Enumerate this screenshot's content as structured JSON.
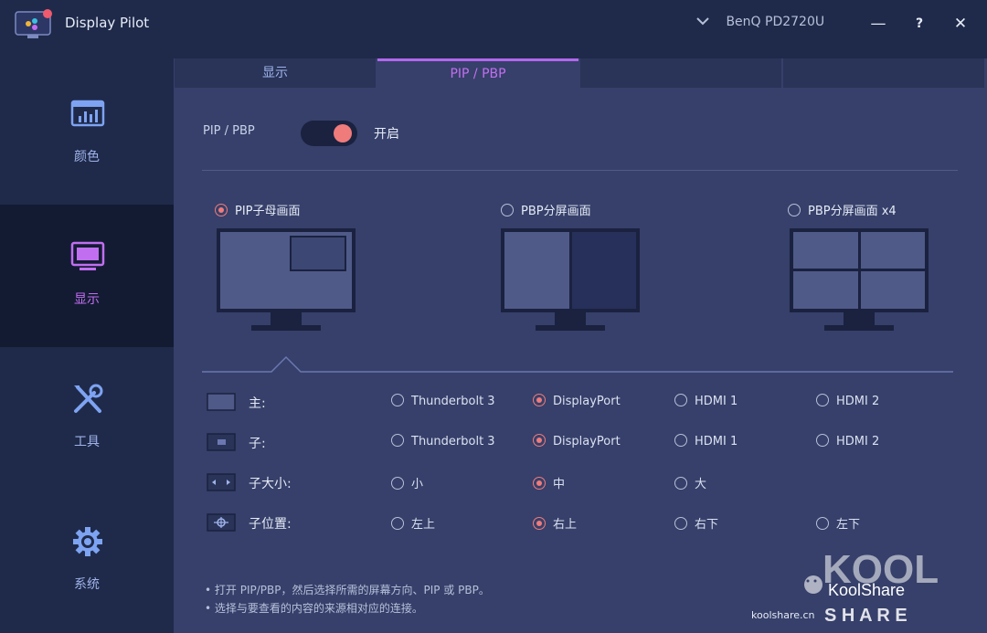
{
  "app": {
    "title": "Display Pilot",
    "monitor": "BenQ PD2720U",
    "minimize": "—",
    "help": "?",
    "close": "✕"
  },
  "sidebar": {
    "items": [
      {
        "label": "颜色",
        "icon": "bar-chart-icon",
        "active": false
      },
      {
        "label": "显示",
        "icon": "monitor-icon",
        "active": true
      },
      {
        "label": "工具",
        "icon": "tools-icon",
        "active": false
      },
      {
        "label": "系统",
        "icon": "gear-icon",
        "active": false
      }
    ]
  },
  "tabs": [
    {
      "label": "显示",
      "active": false
    },
    {
      "label": "PIP / PBP",
      "active": true
    },
    {
      "label": "",
      "active": false
    },
    {
      "label": "",
      "active": false
    }
  ],
  "pip": {
    "label": "PIP / PBP",
    "state": "开启",
    "enabled": true
  },
  "modes": [
    {
      "label": "PIP子母画面",
      "selected": true
    },
    {
      "label": "PBP分屏画面",
      "selected": false
    },
    {
      "label": "PBP分屏画面 x4",
      "selected": false
    }
  ],
  "settings": {
    "main": {
      "label": "主:",
      "options": [
        "Thunderbolt 3",
        "DisplayPort",
        "HDMI 1",
        "HDMI 2"
      ],
      "selected": 1
    },
    "sub": {
      "label": "子:",
      "options": [
        "Thunderbolt 3",
        "DisplayPort",
        "HDMI 1",
        "HDMI 2"
      ],
      "selected": 1
    },
    "size": {
      "label": "子大小:",
      "options": [
        "小",
        "中",
        "大"
      ],
      "selected": 1
    },
    "position": {
      "label": "子位置:",
      "options": [
        "左上",
        "右上",
        "右下",
        "左下"
      ],
      "selected": 1
    }
  },
  "notes": [
    "• 打开 PIP/PBP，然后选择所需的屏幕方向、PIP 或 PBP。",
    "• 选择与要查看的内容的来源相对应的连接。"
  ],
  "watermark": {
    "brand": "KoolShare",
    "letters": "S H A R E",
    "site": "koolshare.cn"
  },
  "colors": {
    "background": "#1f2a4a",
    "panel": "#36406a",
    "accent_purple": "#c26ef0",
    "accent_red": "#f07b7b"
  }
}
